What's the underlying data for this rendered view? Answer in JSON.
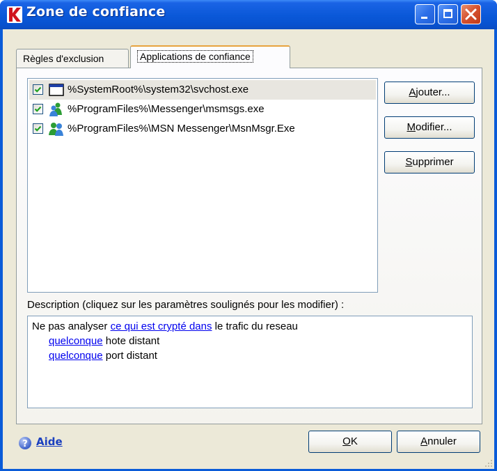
{
  "window": {
    "title": "Zone de confiance",
    "accent_color": "#0a58d8",
    "controls": [
      "minimize-icon",
      "maximize-icon",
      "close-icon"
    ]
  },
  "tabs": [
    {
      "label": "Règles d'exclusion",
      "active": false
    },
    {
      "label": "Applications de confiance",
      "active": true
    }
  ],
  "apps": [
    {
      "checked": true,
      "icon": "window-icon",
      "path": "%SystemRoot%\\system32\\svchost.exe",
      "selected": true
    },
    {
      "checked": true,
      "icon": "messenger-icon",
      "path": "%ProgramFiles%\\Messenger\\msmsgs.exe",
      "selected": false
    },
    {
      "checked": true,
      "icon": "msn-messenger-icon",
      "path": "%ProgramFiles%\\MSN Messenger\\MsnMsgr.Exe",
      "selected": false
    }
  ],
  "buttons": {
    "add": {
      "mnemonic": "A",
      "rest": "jouter..."
    },
    "edit": {
      "mnemonic": "M",
      "rest": "odifier..."
    },
    "delete": {
      "mnemonic": "S",
      "rest": "upprimer"
    }
  },
  "description": {
    "label": "Description (cliquez sur les paramètres soulignés pour les modifier) :",
    "line1_prefix": "Ne pas analyser ",
    "line1_link": "ce qui est crypté dans",
    "line1_suffix": " le trafic du reseau",
    "line2_link": "quelconque",
    "line2_suffix": " hote distant",
    "line3_link": "quelconque",
    "line3_suffix": " port distant"
  },
  "footer": {
    "help_label": "Aide",
    "ok": {
      "mnemonic": "O",
      "rest": "K"
    },
    "cancel": {
      "mnemonic": "A",
      "rest": "nnuler"
    }
  }
}
